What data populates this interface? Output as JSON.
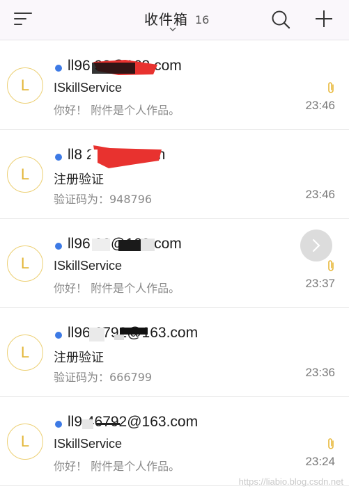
{
  "header": {
    "menu_icon": "menu-lines-icon",
    "title": "收件箱",
    "count": "16",
    "dropdown_icon": "chevron-down-icon",
    "search_icon": "search-icon",
    "compose_icon": "plus-icon"
  },
  "emails": [
    {
      "avatar": "L",
      "sender": "ll96      92@163.com",
      "subject": "ISkillService",
      "preview": "你好！ 附件是个人作品。",
      "time": "23:46",
      "unread": true,
      "has_attachment": true
    },
    {
      "avatar": "L",
      "sender": "ll8          2@163.com",
      "subject": "注册验证",
      "preview": "验证码为：948796",
      "time": "23:46",
      "unread": true,
      "has_attachment": false
    },
    {
      "avatar": "L",
      "sender": "ll96        92@163.com",
      "subject": "ISkillService",
      "preview": "你好！ 附件是个人作品。",
      "time": "23:37",
      "unread": true,
      "has_attachment": true
    },
    {
      "avatar": "L",
      "sender": "ll96    6792@163.com",
      "subject": "注册验证",
      "preview": "验证码为：666799",
      "time": "23:36",
      "unread": true,
      "has_attachment": false
    },
    {
      "avatar": "L",
      "sender": "ll9    46792@163.com",
      "subject": "ISkillService",
      "preview": "你好！ 附件是个人作品。",
      "time": "23:24",
      "unread": true,
      "has_attachment": true
    }
  ],
  "float_button": {
    "icon": "chevron-right-icon"
  },
  "watermark": "https://liabio.blog.csdn.net",
  "colors": {
    "accent_blue": "#3d7ae5",
    "avatar_gold": "#e3b73a",
    "attachment_gold": "#e8b83a",
    "redaction_red": "#e8322f"
  }
}
